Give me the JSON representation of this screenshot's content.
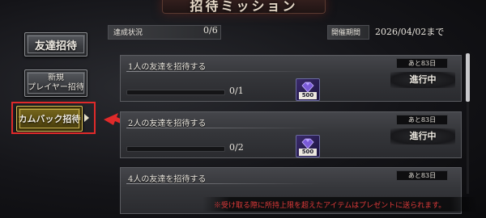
{
  "header": {
    "title": "招待ミッション"
  },
  "sidebar": {
    "items": [
      {
        "label": "友達招待"
      },
      {
        "line1": "新規",
        "line2": "プレイヤー招待"
      },
      {
        "label": "カムバック招待"
      }
    ]
  },
  "status": {
    "achieve_label": "達成状況",
    "achieve_value": "0/6",
    "period_label": "開催期間",
    "period_value": "2026/04/02まで"
  },
  "missions": [
    {
      "name": "1人の友達を招待する",
      "progress_text": "0/1",
      "progress_ratio": 0,
      "reward_qty": "500",
      "days_left": "あと83日",
      "status": "進行中"
    },
    {
      "name": "2人の友達を招待する",
      "progress_text": "0/2",
      "progress_ratio": 0,
      "reward_qty": "500",
      "days_left": "あと83日",
      "status": "進行中"
    },
    {
      "name": "4人の友達を招待する",
      "progress_text": "",
      "progress_ratio": 0,
      "reward_qty": "",
      "days_left": "あと83日",
      "status": ""
    }
  ],
  "footer": {
    "note": "※受け取る際に所持上限を超えたアイテムはプレゼントに送られます。"
  },
  "colors": {
    "highlight": "#e02a2a",
    "note_text": "#e03a3a",
    "active_tab": "#7a6a1e"
  },
  "icons": {
    "reward": "gem-pack-icon",
    "active_indicator": "triangle-right-icon"
  }
}
